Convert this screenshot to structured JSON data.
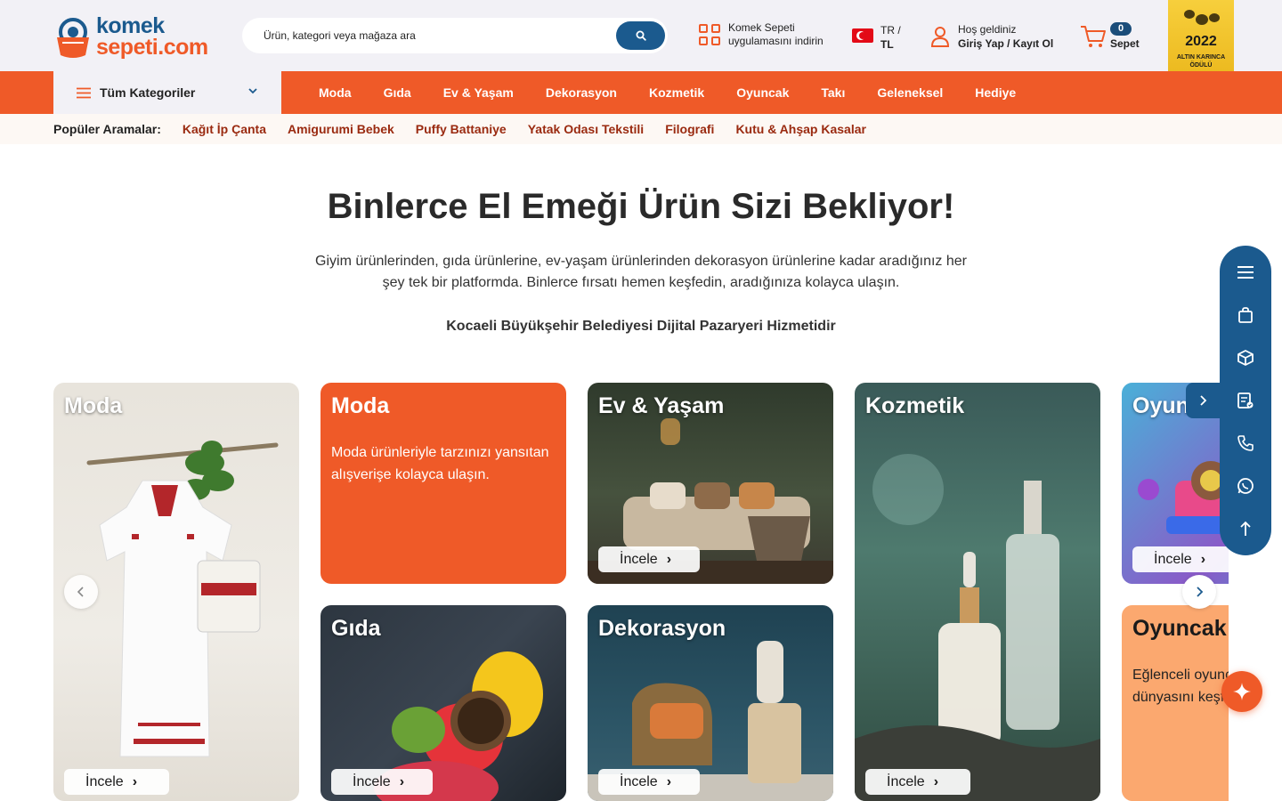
{
  "header": {
    "logo_line1": "komek",
    "logo_line2": "sepeti.com",
    "search_placeholder": "Ürün, kategori veya mağaza ara",
    "app_line1": "Komek Sepeti",
    "app_line2": "uygulamasını indirin",
    "lang_line1": "TR /",
    "lang_line2": "TL",
    "welcome": "Hoş geldiniz",
    "login": "Giriş Yap / Kayıt Ol",
    "cart_count": "0",
    "cart_label": "Sepet",
    "award_year": "2022",
    "award_sub1": "ALTIN KARINCA",
    "award_sub2": "ÖDÜLÜ"
  },
  "nav": {
    "all_categories": "Tüm Kategoriler",
    "items": [
      "Moda",
      "Gıda",
      "Ev & Yaşam",
      "Dekorasyon",
      "Kozmetik",
      "Oyuncak",
      "Takı",
      "Geleneksel",
      "Hediye"
    ]
  },
  "popular": {
    "label": "Popüler Aramalar:",
    "items": [
      "Kağıt İp Çanta",
      "Amigurumi Bebek",
      "Puffy Battaniye",
      "Yatak Odası Tekstili",
      "Filografi",
      "Kutu & Ahşap Kasalar"
    ]
  },
  "hero": {
    "title": "Binlerce El Emeği Ürün Sizi Bekliyor!",
    "desc_line1": "Giyim ürünlerinden, gıda ürünlerine, ev-yaşam ürünlerinden dekorasyon ürünlerine kadar aradığınız her",
    "desc_line2": "şey tek bir platformda. Binlerce fırsatı hemen keşfedin, aradığınıza kolayca ulaşın.",
    "sub": "Kocaeli Büyükşehir Belediyesi Dijital Pazaryeri Hizmetidir"
  },
  "cards": {
    "incele": "İncele",
    "moda_img_title": "Moda",
    "moda_text_title": "Moda",
    "moda_desc": "Moda ürünleriyle tarzınızı yansıtan alışverişe kolayca ulaşın.",
    "ev_title": "Ev & Yaşam",
    "kozmetik_title": "Kozmetik",
    "oyuncak_img_title": "Oyuncak",
    "gida_title": "Gıda",
    "dekorasyon_title": "Dekorasyon",
    "oyuncak_text_title": "Oyuncak",
    "oyuncak_desc": "Eğlenceli oyuncaklarla hayal dünyasını keşfedin."
  },
  "colors": {
    "brand_orange": "#ef5a28",
    "brand_blue": "#1b5a8e",
    "header_bg": "#f2f1f6",
    "popular_text": "#9a2a10",
    "oyuncak_text_card": "#fba86f"
  }
}
